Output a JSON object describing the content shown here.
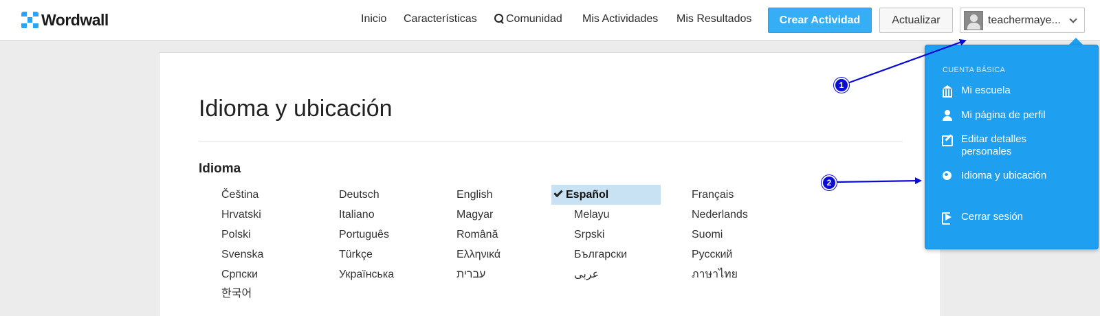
{
  "header": {
    "logo_text": "Wordwall",
    "nav": {
      "home": "Inicio",
      "features": "Características",
      "community": "Comunidad",
      "my_activities": "Mis Actividades",
      "my_results": "Mis Resultados"
    },
    "create_button": "Crear Actividad",
    "update_button": "Actualizar",
    "user_name": "teachermaye..."
  },
  "main": {
    "title": "Idioma y ubicación",
    "language_section": "Idioma",
    "languages": [
      [
        "Čeština",
        "Deutsch",
        "English",
        "Español",
        "Français"
      ],
      [
        "Hrvatski",
        "Italiano",
        "Magyar",
        "Melayu",
        "Nederlands"
      ],
      [
        "Polski",
        "Português",
        "Română",
        "Srpski",
        "Suomi"
      ],
      [
        "Svenska",
        "Türkçe",
        "Ελληνικά",
        "Български",
        "Русский"
      ],
      [
        "Српски",
        "Українська",
        "עברית",
        "عربى",
        "ภาษาไทย"
      ],
      [
        "한국어"
      ]
    ],
    "selected_language": "Español"
  },
  "dropdown": {
    "header": "Cuenta básica",
    "items": [
      {
        "label": "Mi escuela",
        "icon": "school-icon"
      },
      {
        "label": "Mi página de perfil",
        "icon": "user-icon"
      },
      {
        "label": "Editar detalles personales",
        "icon": "edit-icon"
      },
      {
        "label": "Idioma y ubicación",
        "icon": "globe-icon"
      },
      {
        "label": "Cerrar sesión",
        "icon": "sign-out-icon"
      }
    ]
  },
  "annotations": {
    "badge_1": "1",
    "badge_2": "2"
  },
  "colors": {
    "accent": "#35aef6",
    "dropdown_bg": "#1e9ff0",
    "selected_bg": "#c9e2f3",
    "annotation": "#0b0bd6"
  }
}
